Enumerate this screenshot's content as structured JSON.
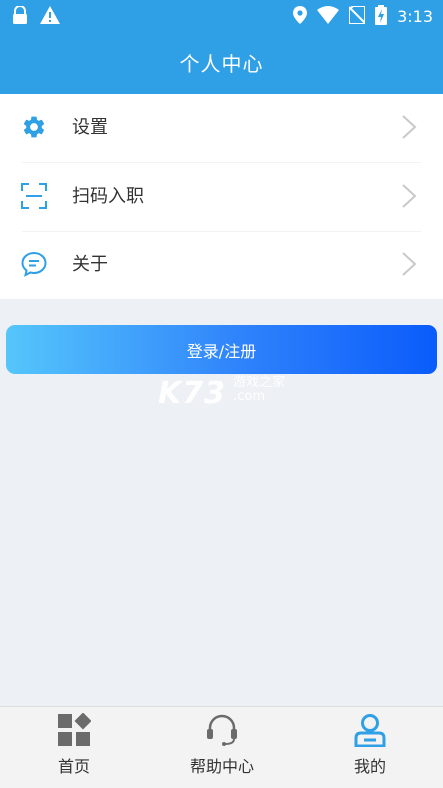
{
  "status_bar": {
    "time": "3:13"
  },
  "header": {
    "title": "个人中心"
  },
  "menu": {
    "items": [
      {
        "label": "设置",
        "icon": "gear-icon"
      },
      {
        "label": "扫码入职",
        "icon": "scan-icon"
      },
      {
        "label": "关于",
        "icon": "chat-bubble-icon"
      }
    ]
  },
  "login_button": {
    "label": "登录/注册"
  },
  "watermark": {
    "main": "K73",
    "cn": "游戏之家",
    "domain": ".com"
  },
  "tab_bar": {
    "tabs": [
      {
        "label": "首页",
        "icon": "home-grid-icon"
      },
      {
        "label": "帮助中心",
        "icon": "headset-icon"
      },
      {
        "label": "我的",
        "icon": "user-icon"
      }
    ]
  },
  "colors": {
    "header_bg": "#2f9fe6",
    "accent_blue": "#2f9fe6",
    "active_tab": "#2f9fe6",
    "page_bg": "#edf1f6",
    "button_gradient_start": "#55c6fb",
    "button_gradient_end": "#0a5cfb"
  }
}
